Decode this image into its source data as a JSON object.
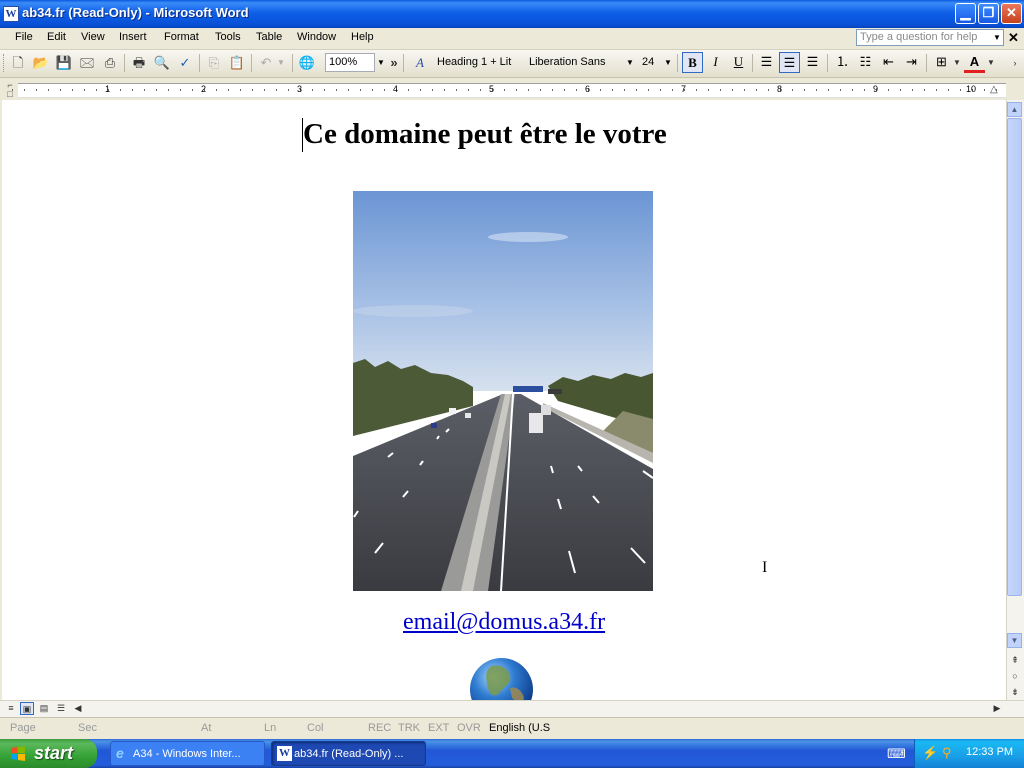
{
  "window": {
    "title": "ab34.fr (Read-Only) - Microsoft Word",
    "app_icon_letter": "W",
    "buttons": [
      "minimize",
      "restore",
      "close"
    ]
  },
  "menubar": {
    "items": [
      {
        "label": "File"
      },
      {
        "label": "Edit"
      },
      {
        "label": "View"
      },
      {
        "label": "Insert"
      },
      {
        "label": "Format"
      },
      {
        "label": "Tools"
      },
      {
        "label": "Table"
      },
      {
        "label": "Window"
      },
      {
        "label": "Help"
      }
    ],
    "help_placeholder": "Type a question for help",
    "close_glyph": "✕"
  },
  "toolbar": {
    "zoom": "100%",
    "style": "Heading 1 + Lit",
    "font": "Liberation Sans",
    "font_size": "24",
    "bold": "B",
    "italic": "I",
    "underline": "U",
    "font_color_letter": "A",
    "overflow_glyph": "»",
    "font_color": "#e02020"
  },
  "ruler": {
    "numbers": [
      "1",
      "2",
      "3",
      "4",
      "5",
      "6",
      "7",
      "8",
      "9",
      "10"
    ]
  },
  "document": {
    "heading": "Ce domaine peut être le votre",
    "email": "email@domus.a34.fr",
    "image": "highway-photo",
    "globe": "globe-image"
  },
  "statusbar": {
    "page": "Page",
    "sec": "Sec",
    "at": "At",
    "ln": "Ln",
    "col": "Col",
    "rec": "REC",
    "trk": "TRK",
    "ext": "EXT",
    "ovr": "OVR",
    "language": "English (U.S"
  },
  "taskbar": {
    "start_label": "start",
    "tasks": [
      {
        "label": "A34 - Windows Inter...",
        "icon": "ie-icon",
        "active": false
      },
      {
        "label": "ab34.fr (Read-Only) ...",
        "icon": "word-icon",
        "active": true
      }
    ],
    "clock": "12:33 PM"
  },
  "colors": {
    "titlebar": "#0a58e0",
    "link": "#0000cc",
    "taskbar": "#245edb",
    "start": "#3c9a3c"
  }
}
